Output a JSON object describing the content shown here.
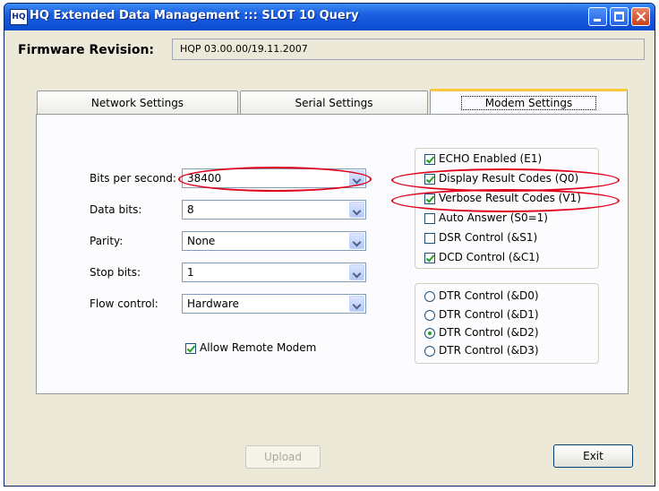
{
  "window": {
    "title": "HQ Extended Data Management ::: SLOT 10  Query",
    "icon_text": "HQ"
  },
  "firmware": {
    "label": "Firmware Revision:",
    "value": "HQP 03.00.00/19.11.2007"
  },
  "tabs": [
    {
      "label": "Network Settings",
      "active": false
    },
    {
      "label": "Serial Settings",
      "active": false
    },
    {
      "label": "Modem Settings",
      "active": true
    }
  ],
  "fields": [
    {
      "label": "Bits per second:",
      "value": "38400"
    },
    {
      "label": "Data bits:",
      "value": "8"
    },
    {
      "label": "Parity:",
      "value": "None"
    },
    {
      "label": "Stop bits:",
      "value": "1"
    },
    {
      "label": "Flow control:",
      "value": "Hardware"
    }
  ],
  "allow_remote": {
    "label": "Allow Remote Modem",
    "checked": true
  },
  "checkboxes": [
    {
      "label": "ECHO Enabled (E1)",
      "checked": true
    },
    {
      "label": "Display Result Codes (Q0)",
      "checked": true
    },
    {
      "label": "Verbose Result Codes (V1)",
      "checked": true
    },
    {
      "label": "Auto Answer (S0=1)",
      "checked": false
    },
    {
      "label": "DSR Control (&S1)",
      "checked": false
    },
    {
      "label": "DCD Control (&C1)",
      "checked": true
    }
  ],
  "radios": [
    {
      "label": "DTR Control (&D0)",
      "selected": false
    },
    {
      "label": "DTR Control (&D1)",
      "selected": false
    },
    {
      "label": "DTR Control (&D2)",
      "selected": true
    },
    {
      "label": "DTR Control (&D3)",
      "selected": false
    }
  ],
  "buttons": {
    "upload": "Upload",
    "exit": "Exit"
  },
  "colors": {
    "title_bar": "#1b5fe0",
    "annotation": "#e0001b",
    "active_tab_accent": "#ffc83c"
  }
}
